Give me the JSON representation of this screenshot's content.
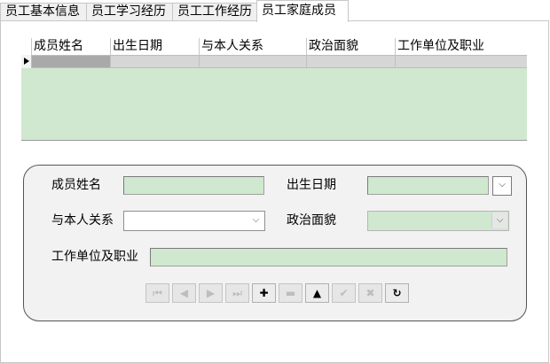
{
  "tabs": [
    {
      "label": "员工基本信息",
      "active": false
    },
    {
      "label": "员工学习经历",
      "active": false
    },
    {
      "label": "员工工作经历",
      "active": false
    },
    {
      "label": "员工家庭成员",
      "active": true
    }
  ],
  "grid": {
    "columns": [
      "成员姓名",
      "出生日期",
      "与本人关系",
      "政治面貌",
      "工作单位及职业"
    ],
    "rows": [
      [
        "",
        "",
        "",
        "",
        ""
      ]
    ],
    "background_color": "#cfe8cf",
    "current_row_indicator": "triangle-right-icon"
  },
  "form": {
    "name_label": "成员姓名",
    "name_value": "",
    "birth_label": "出生日期",
    "birth_value": "",
    "relation_label": "与本人关系",
    "relation_value": "",
    "political_label": "政治面貌",
    "political_value": "",
    "work_label": "工作单位及职业",
    "work_value": ""
  },
  "navigator": {
    "buttons": [
      {
        "icon": "first-record-icon",
        "glyph": "⏮",
        "enabled": false
      },
      {
        "icon": "prior-record-icon",
        "glyph": "◀",
        "enabled": false
      },
      {
        "icon": "next-record-icon",
        "glyph": "▶",
        "enabled": false
      },
      {
        "icon": "last-record-icon",
        "glyph": "⏭",
        "enabled": false
      },
      {
        "icon": "insert-record-icon",
        "glyph": "✚",
        "enabled": true
      },
      {
        "icon": "delete-record-icon",
        "glyph": "▬",
        "enabled": false
      },
      {
        "icon": "edit-record-icon",
        "glyph": "▲",
        "enabled": true
      },
      {
        "icon": "post-record-icon",
        "glyph": "✔",
        "enabled": false
      },
      {
        "icon": "cancel-record-icon",
        "glyph": "✖",
        "enabled": false
      },
      {
        "icon": "refresh-record-icon",
        "glyph": "↻",
        "enabled": true
      }
    ]
  },
  "colors": {
    "field_green": "#cfe8cf",
    "form_background": "#f2f2f2",
    "selected_cell": "#a9a9a9"
  }
}
